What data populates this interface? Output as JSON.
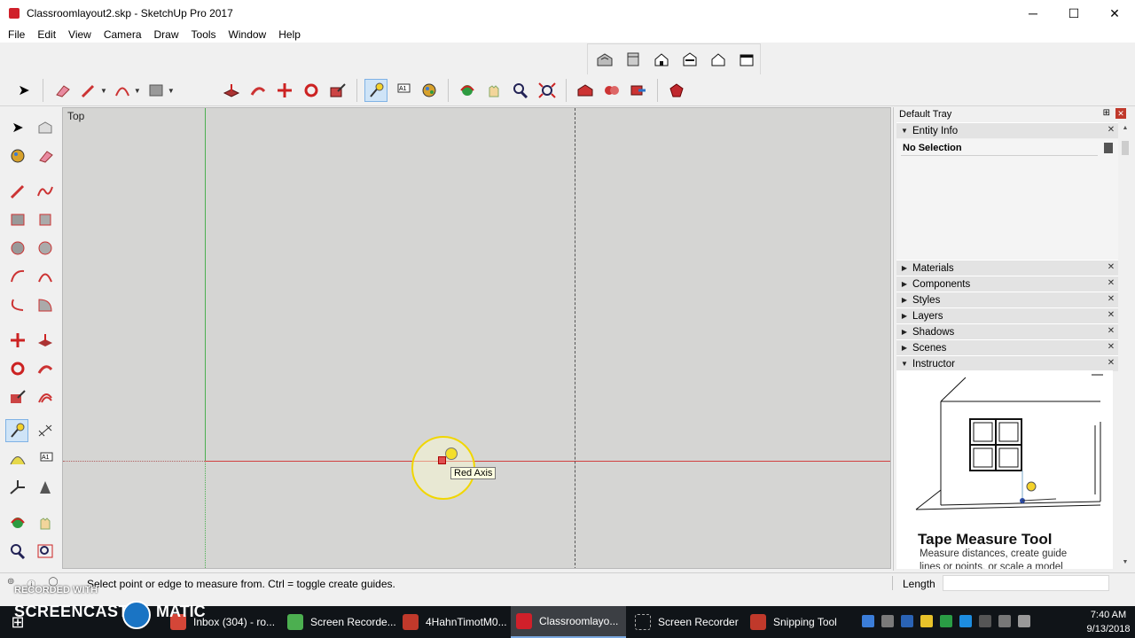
{
  "window": {
    "title": "Classroomlayout2.skp - SketchUp Pro 2017",
    "minimize": "─",
    "maximize": "☐",
    "close": "✕"
  },
  "menu": [
    "File",
    "Edit",
    "View",
    "Camera",
    "Draw",
    "Tools",
    "Window",
    "Help"
  ],
  "viewport": {
    "view_label": "Top",
    "tooltip": "Red Axis"
  },
  "tray": {
    "title": "Default Tray",
    "pin": "⊞",
    "close": "✕",
    "entity_info": {
      "label": "Entity Info",
      "selection": "No Selection"
    },
    "panels": [
      "Materials",
      "Components",
      "Styles",
      "Layers",
      "Shadows",
      "Scenes",
      "Instructor"
    ],
    "instructor": {
      "tool_title": "Tape Measure Tool",
      "description": "Measure distances, create guide lines or points, or scale a model"
    }
  },
  "status": {
    "hint": "Select point or edge to measure from.  Ctrl = toggle create guides.",
    "measurement_label": "Length",
    "measurement_value": ""
  },
  "recorder": {
    "recorded_with": "RECORDED WITH",
    "brand_left": "SCREENCAST",
    "brand_right": "MATIC"
  },
  "taskbar": {
    "items": [
      {
        "label": "Inbox (304) - ro...",
        "color": "#d44638"
      },
      {
        "label": "Screen Recorde...",
        "color": "#4caf50"
      },
      {
        "label": "4HahnTimotM0...",
        "color": "#c0392b"
      },
      {
        "label": "Classroomlayo...",
        "color": "#d0202a"
      },
      {
        "label": "Screen Recorder",
        "color": "#888888"
      },
      {
        "label": "Snipping Tool",
        "color": "#c0392b"
      }
    ],
    "time": "7:40 AM",
    "date": "9/13/2018"
  },
  "colors": {
    "viewport_bg": "#d5d5d3",
    "red_axis": "#d14040",
    "green_axis": "#4caf50",
    "active_tool": "#cfe4f7"
  }
}
